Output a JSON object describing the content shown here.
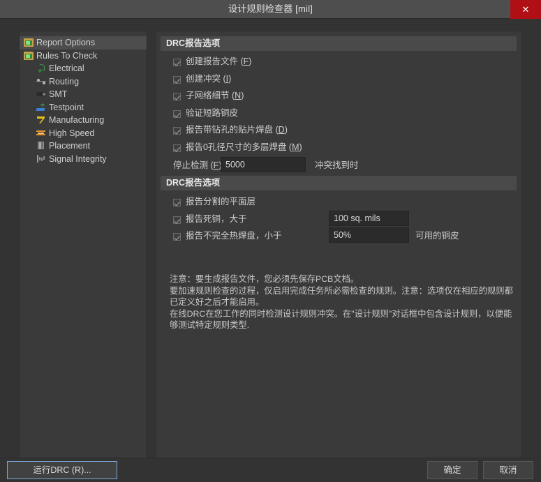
{
  "window": {
    "title": "设计规则检查器 [mil]",
    "close_label": "✕"
  },
  "sidebar": {
    "items": [
      {
        "label": "Report Options",
        "icon": "folder-report-icon",
        "selected": true,
        "level": 0
      },
      {
        "label": "Rules To Check",
        "icon": "folder-rules-icon",
        "selected": false,
        "level": 0
      },
      {
        "label": "Electrical",
        "icon": "electrical-icon",
        "selected": false,
        "level": 1
      },
      {
        "label": "Routing",
        "icon": "routing-icon",
        "selected": false,
        "level": 1
      },
      {
        "label": "SMT",
        "icon": "smt-icon",
        "selected": false,
        "level": 1
      },
      {
        "label": "Testpoint",
        "icon": "testpoint-icon",
        "selected": false,
        "level": 1
      },
      {
        "label": "Manufacturing",
        "icon": "manufacturing-icon",
        "selected": false,
        "level": 1
      },
      {
        "label": "High Speed",
        "icon": "high-speed-icon",
        "selected": false,
        "level": 1
      },
      {
        "label": "Placement",
        "icon": "placement-icon",
        "selected": false,
        "level": 1
      },
      {
        "label": "Signal Integrity",
        "icon": "signal-integrity-icon",
        "selected": false,
        "level": 1
      }
    ]
  },
  "main": {
    "section1": {
      "header": "DRC报告选项",
      "checkboxes": [
        {
          "label": "创建报告文件",
          "mnemonic": "F",
          "checked": true
        },
        {
          "label": "创建冲突",
          "mnemonic": "I",
          "checked": true
        },
        {
          "label": "子网络细节",
          "mnemonic": "N",
          "checked": true
        },
        {
          "label": "验证短路铜皮",
          "mnemonic": "",
          "checked": true
        },
        {
          "label": "报告带钻孔的贴片焊盘",
          "mnemonic": "D",
          "checked": true
        },
        {
          "label": "报告0孔径尺寸的多层焊盘",
          "mnemonic": "M",
          "checked": true
        }
      ],
      "stop_row": {
        "label": "停止检测",
        "mnemonic": "F",
        "value": "5000",
        "suffix": "冲突找到时"
      }
    },
    "section2": {
      "header": "DRC报告选项",
      "rows": [
        {
          "label": "报告分割的平面层",
          "checked": true,
          "value": null,
          "suffix": null
        },
        {
          "label": "报告死铜，大于",
          "checked": true,
          "value": "100 sq. mils",
          "suffix": null
        },
        {
          "label": "报告不完全热焊盘，小于",
          "checked": true,
          "value": "50%",
          "suffix": "可用的铜皮"
        }
      ]
    },
    "note": {
      "line1": "注意：要生成报告文件，您必须先保存PCB文档。",
      "line2": "要加速规则检查的过程，仅启用完成任务所必需检查的规则。注意：选项仅在相应的规则都已定义好之后才能启用。",
      "line3": "在线DRC在您工作的同时检测设计规则冲突。在\"设计规则\"对话框中包含设计规则，以便能够测试特定规则类型."
    }
  },
  "footer": {
    "run_drc": "运行DRC (R)...",
    "ok": "确定",
    "cancel": "取消"
  },
  "colors": {
    "window_bg": "#333333",
    "panel_bg": "#3a3a3a",
    "titlebar_bg": "#4e4e4e",
    "close_red": "#b01015",
    "section_header_bg": "#4a4a4a",
    "field_bg": "#2b2b2b",
    "selection_bg": "#4d4d4d",
    "focus_border": "#7aa7d4"
  }
}
